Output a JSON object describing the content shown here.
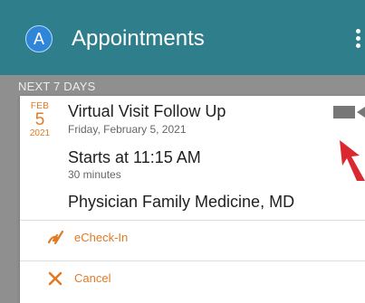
{
  "appbar": {
    "avatar_initial": "A",
    "title": "Appointments"
  },
  "section": {
    "header": "NEXT 7 DAYS"
  },
  "appointment": {
    "date_month": "FEB",
    "date_day": "5",
    "date_year": "2021",
    "title": "Virtual Visit Follow Up",
    "date_full": "Friday, February 5, 2021",
    "start": "Starts at 11:15 AM",
    "duration": "30 minutes",
    "provider": "Physician Family Medicine, MD",
    "visit_type_icon": "video-camera-icon"
  },
  "actions": [
    {
      "label": "eCheck-In",
      "icon": "echeckin-icon"
    },
    {
      "label": "Cancel",
      "icon": "close-icon"
    }
  ],
  "colors": {
    "appbar": "#2f7e8b",
    "avatar": "#2f86d8",
    "accent": "#e07b24",
    "background": "#8f8f8f",
    "arrow": "#d9282f"
  }
}
